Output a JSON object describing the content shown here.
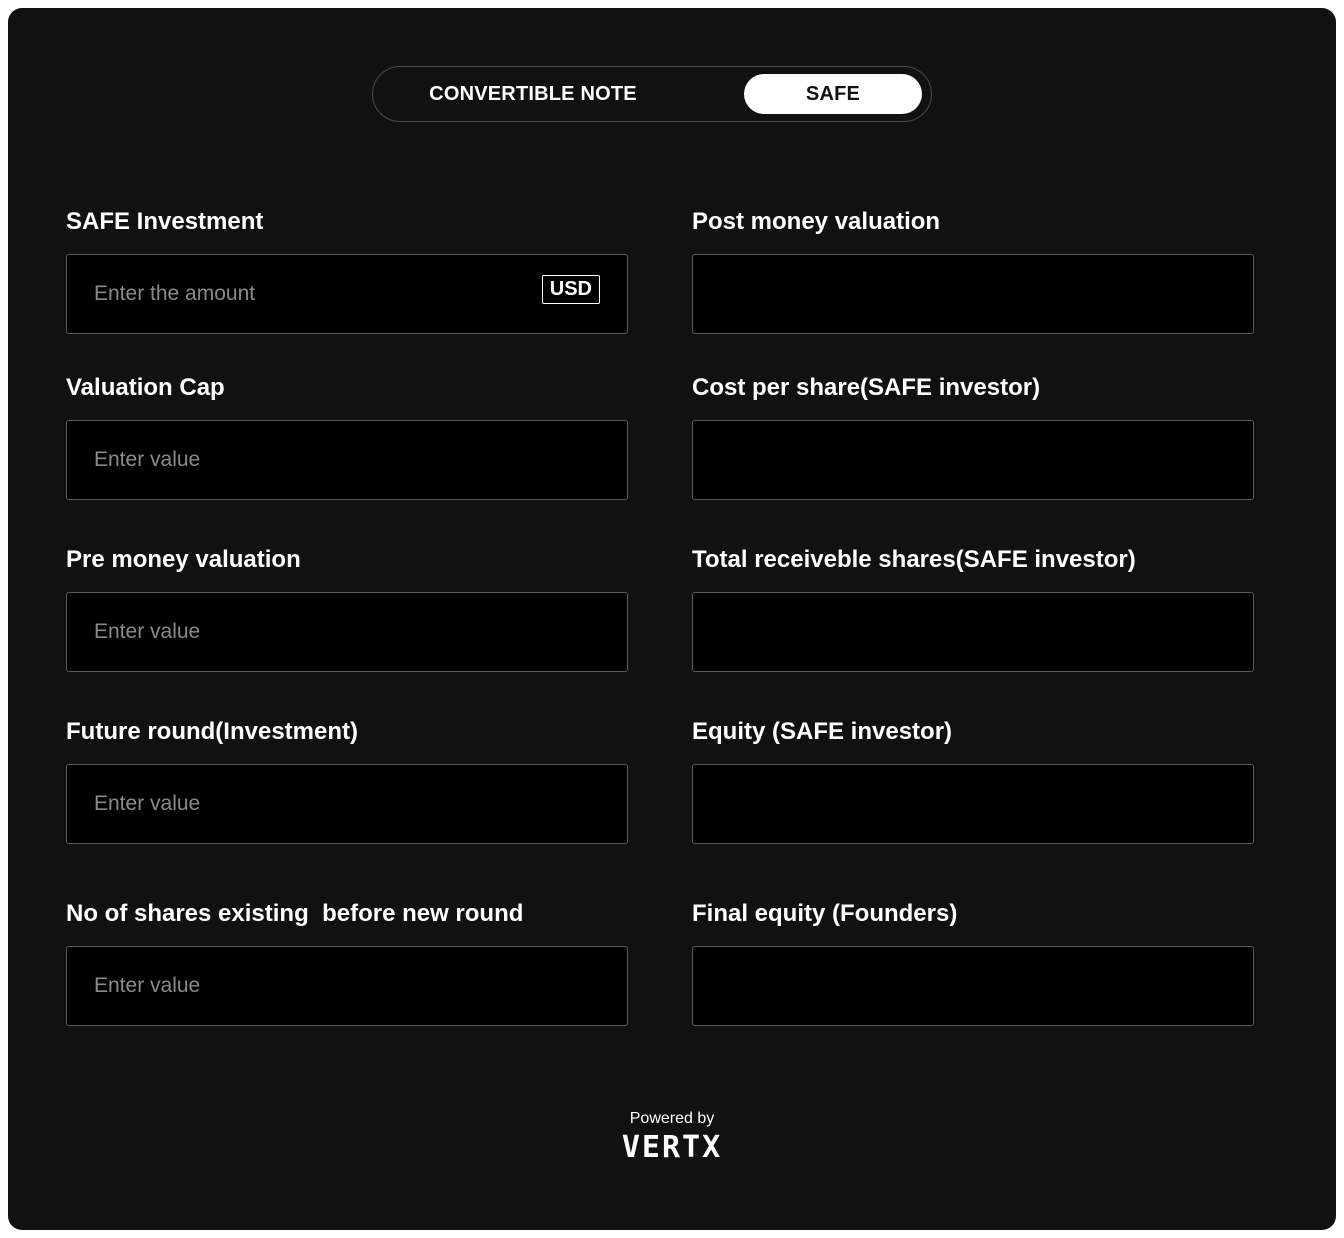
{
  "toggle": {
    "options": [
      "CONVERTIBLE NOTE",
      "SAFE"
    ],
    "selected": "SAFE"
  },
  "left_fields": [
    {
      "label": "SAFE Investment",
      "placeholder": "Enter the amount",
      "unit": "USD",
      "value": ""
    },
    {
      "label": "Valuation Cap",
      "placeholder": "Enter value",
      "value": ""
    },
    {
      "label": "Pre money valuation",
      "placeholder": "Enter value",
      "value": ""
    },
    {
      "label": "Future round(Investment)",
      "placeholder": "Enter value",
      "value": ""
    },
    {
      "label": "No of shares existing  before new round",
      "placeholder": "Enter value",
      "value": ""
    }
  ],
  "right_fields": [
    {
      "label": "Post money valuation",
      "value": ""
    },
    {
      "label": "Cost per share(SAFE investor)",
      "value": ""
    },
    {
      "label": "Total receiveble shares(SAFE investor)",
      "value": ""
    },
    {
      "label": "Equity (SAFE investor)",
      "value": ""
    },
    {
      "label": "Final equity (Founders)",
      "value": ""
    }
  ],
  "footer": {
    "powered_by": "Powered by",
    "brand": "VERTX"
  },
  "colors": {
    "background": "#111111",
    "field_background": "#000000",
    "field_border": "#5a5a5a",
    "text": "#ffffff",
    "placeholder": "#8a8a8a",
    "toggle_active_bg": "#ffffff",
    "toggle_active_text": "#111111"
  }
}
